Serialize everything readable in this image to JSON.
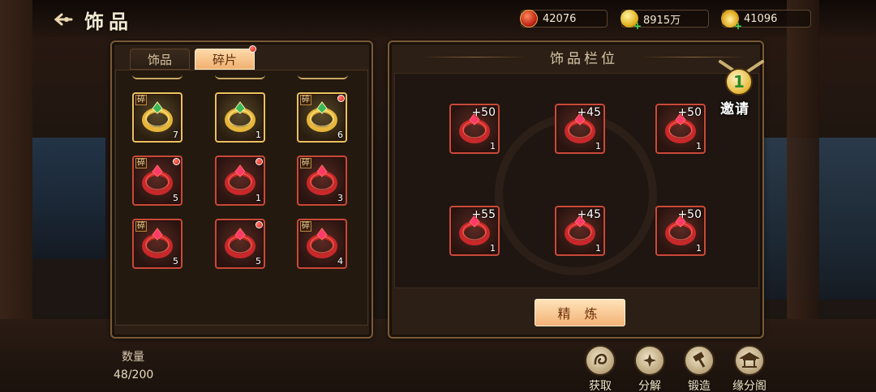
{
  "header": {
    "title": "饰品"
  },
  "resources": [
    {
      "icon": "red-token-icon",
      "value": "42076"
    },
    {
      "icon": "gold-coin-icon",
      "value": "8915万"
    },
    {
      "icon": "gold-ingot-icon",
      "value": "41096"
    }
  ],
  "tabs": [
    {
      "label": "饰品",
      "active": false
    },
    {
      "label": "碎片",
      "active": true
    }
  ],
  "fragment_badge": "碎",
  "inventory": [
    {
      "icon": "gold-spiral-ring-icon",
      "count": "7",
      "fragment": true,
      "new": false,
      "color": "gold"
    },
    {
      "icon": "jade-gold-ring-icon",
      "count": "1",
      "fragment": false,
      "new": false,
      "color": "gold"
    },
    {
      "icon": "gold-crown-ring-icon",
      "count": "6",
      "fragment": true,
      "new": true,
      "color": "gold"
    },
    {
      "icon": "red-crystal-ring-icon",
      "count": "5",
      "fragment": true,
      "new": true,
      "color": "red"
    },
    {
      "icon": "crimson-bead-ring-icon",
      "count": "1",
      "fragment": false,
      "new": true,
      "color": "red"
    },
    {
      "icon": "gem-gold-ring-icon",
      "count": "3",
      "fragment": true,
      "new": false,
      "color": "red"
    },
    {
      "icon": "red-pendant-ring-icon",
      "count": "5",
      "fragment": true,
      "new": false,
      "color": "red"
    },
    {
      "icon": "ruby-band-icon",
      "count": "5",
      "fragment": false,
      "new": true,
      "color": "red"
    },
    {
      "icon": "gold-jewel-ring-icon",
      "count": "4",
      "fragment": true,
      "new": false,
      "color": "red"
    }
  ],
  "slots_title": "饰品栏位",
  "slots": [
    {
      "icon": "red-crystal-ring-icon",
      "level": "+50",
      "count": "1"
    },
    {
      "icon": "crimson-bead-ring-icon",
      "level": "+45",
      "count": "1"
    },
    {
      "icon": "gem-gold-ring-icon",
      "level": "+50",
      "count": "1"
    },
    {
      "icon": "red-pendant-ring-icon",
      "level": "+55",
      "count": "1"
    },
    {
      "icon": "ruby-band-icon",
      "level": "+45",
      "count": "1"
    },
    {
      "icon": "gold-jewel-ring-icon",
      "level": "+50",
      "count": "1"
    }
  ],
  "refine_label": "精 炼",
  "quantity": {
    "label": "数量",
    "value": "48/200"
  },
  "actions": [
    {
      "icon": "acquire-icon",
      "label": "获取"
    },
    {
      "icon": "decompose-icon",
      "label": "分解"
    },
    {
      "icon": "forge-hammer-icon",
      "label": "锻造"
    },
    {
      "icon": "pavilion-icon",
      "label": "缘分阁"
    }
  ],
  "invite": {
    "number": "1",
    "label": "邀请"
  },
  "colors": {
    "red_border": "#c84a3a",
    "gold_border": "#e8c260",
    "tab_active": "#f0b070",
    "panel_border": "#7a5a36"
  }
}
